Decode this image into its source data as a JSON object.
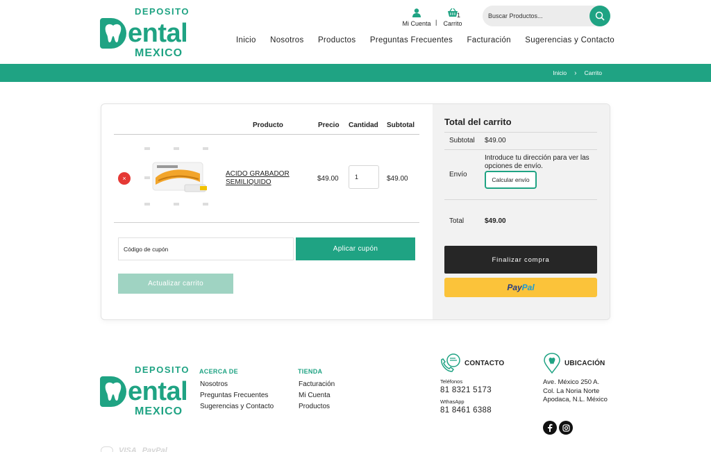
{
  "logo": {
    "top": "DEPOSITO",
    "ental": "ental",
    "bottom": "MEXICO"
  },
  "header": {
    "account_label": "Mi Cuenta",
    "separator": "|",
    "cart_label": "Carrito",
    "cart_count": "1",
    "search_placeholder": "Buscar Productos..."
  },
  "nav": [
    "Inicio",
    "Nosotros",
    "Productos",
    "Preguntas Frecuentes",
    "Facturación",
    "Sugerencias y Contacto"
  ],
  "breadcrumb": {
    "home": "Inicio",
    "arrow": "›",
    "current": "Carrito"
  },
  "cart": {
    "columns": {
      "product": "Producto",
      "price": "Precio",
      "quantity": "Cantidad",
      "subtotal": "Subtotal"
    },
    "items": [
      {
        "name": "ACIDO GRABADOR SEMILIQUIDO",
        "price": "$49.00",
        "quantity": "1",
        "subtotal": "$49.00",
        "remove": "×"
      }
    ],
    "coupon_placeholder": "Código de cupón",
    "apply_coupon": "Aplicar cupón",
    "update_cart": "Actualizar carrito"
  },
  "totals": {
    "title": "Total del carrito",
    "subtotal_label": "Subtotal",
    "subtotal_value": "$49.00",
    "shipping_label": "Envío",
    "shipping_text": "Introduce tu dirección para ver las opciones de envío.",
    "calc_shipping": "Calcular envío",
    "total_label": "Total",
    "total_value": "$49.00",
    "checkout": "Finalizar compra",
    "paypal_pay": "Pay",
    "paypal_pal": "Pal"
  },
  "footer": {
    "about_title": "ACERCA DE",
    "about_links": [
      "Nosotros",
      "Preguntas Frecuentes",
      "Sugerencias y Contacto"
    ],
    "store_title": "TIENDA",
    "store_links": [
      "Facturación",
      "Mi Cuenta",
      "Productos"
    ],
    "contact_title": "CONTACTO",
    "phones_label": "Teléfonos",
    "phone": "81 8321 5173",
    "whatsapp_label": "WthasApp",
    "whatsapp": "81 8461 6388",
    "location_title": "UBICACIÓN",
    "address": [
      "Ave. México 250 A.",
      "Col. La Noria Norte",
      "Apodaca, N.L. México"
    ],
    "payment_visible": [
      "VISA",
      "PayPal"
    ]
  },
  "colors": {
    "brand": "#1fa383",
    "dark": "#262626",
    "paypal": "#fbc33a",
    "remove": "#e53935"
  }
}
